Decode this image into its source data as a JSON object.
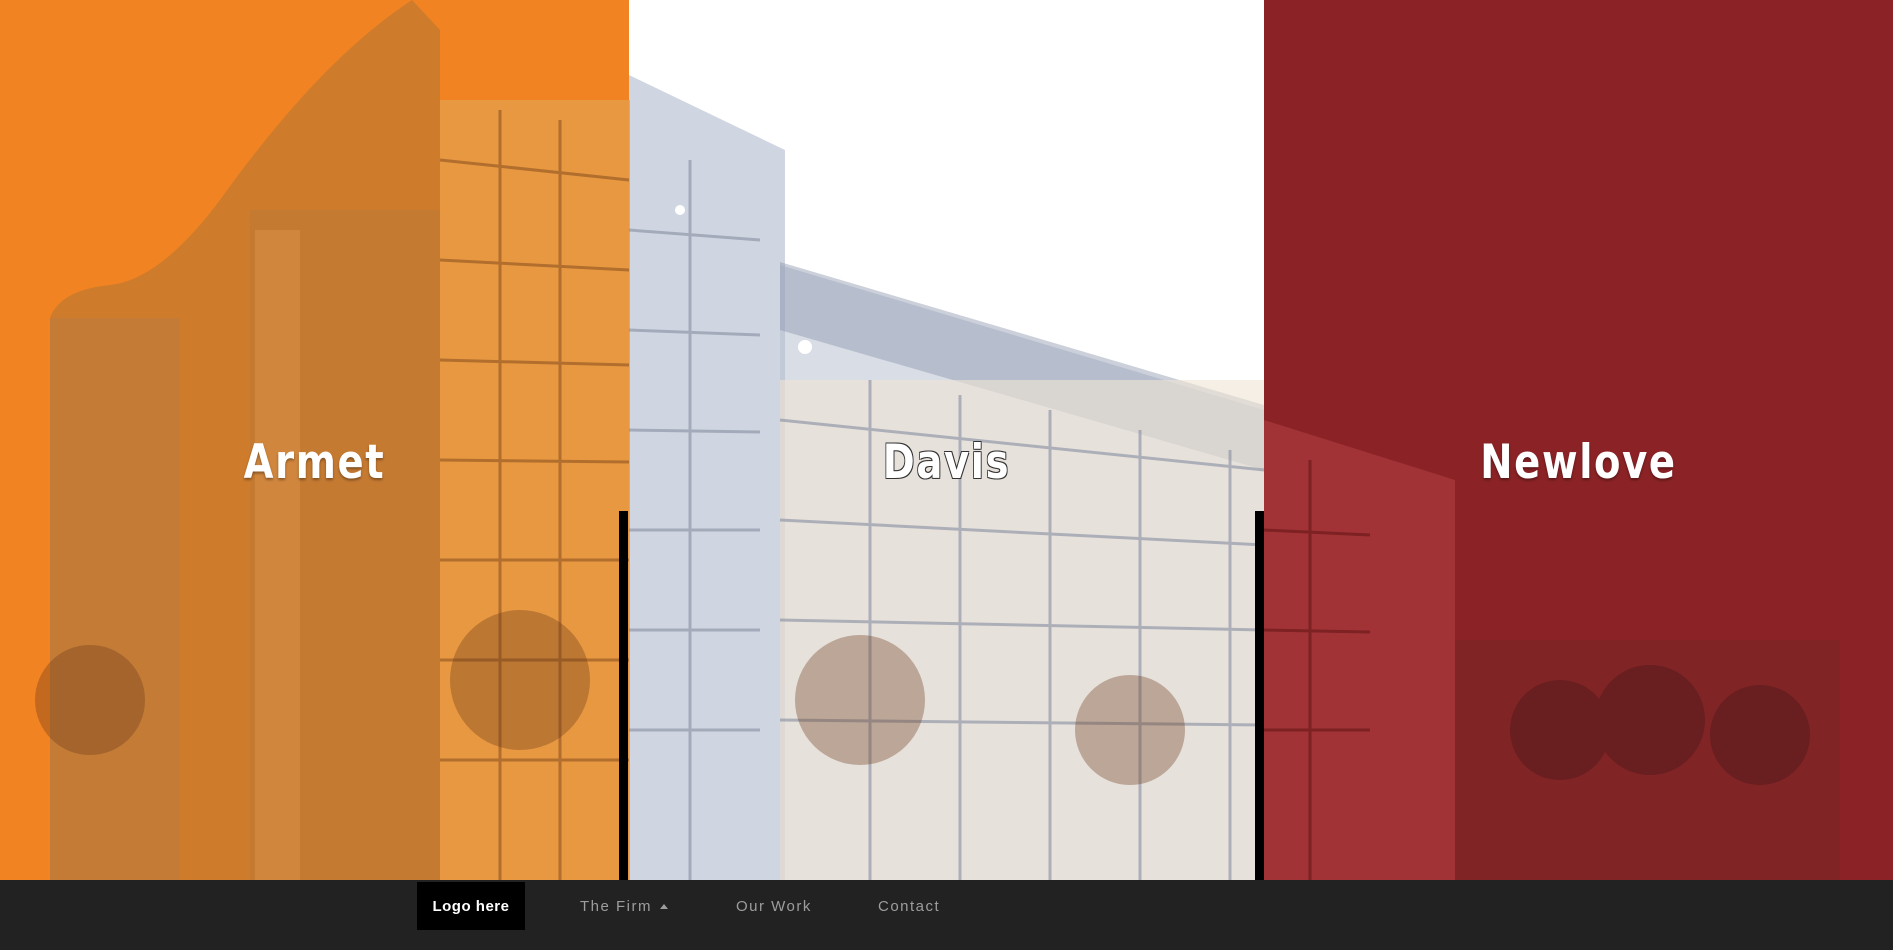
{
  "panels": [
    {
      "title": "Armet",
      "color": "#f28322"
    },
    {
      "title": "Davis",
      "color": "#ffffff"
    },
    {
      "title": "Newlove",
      "color": "#8b2326"
    }
  ],
  "navbar": {
    "brand": "Logo here",
    "items": [
      {
        "label": "The Firm",
        "icon": "caret-up-icon"
      },
      {
        "label": "Our Work"
      },
      {
        "label": "Contact"
      }
    ]
  },
  "colors": {
    "navbar_bg": "#222222",
    "brand_bg": "#000000",
    "nav_text": "#9d9d9d"
  }
}
